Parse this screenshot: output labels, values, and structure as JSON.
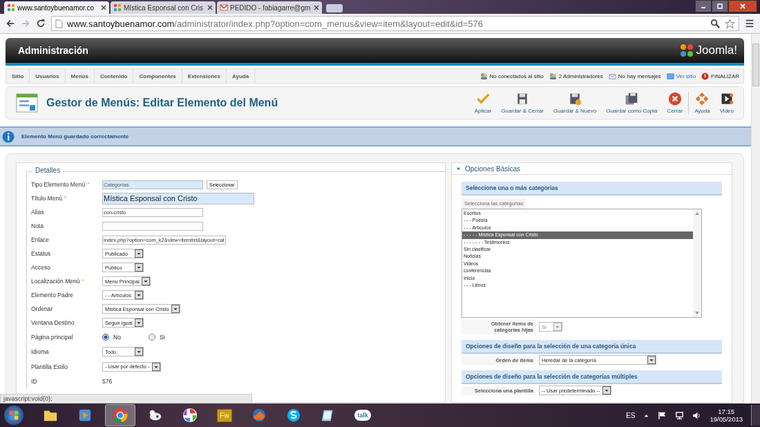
{
  "browser": {
    "tabs": [
      {
        "title": "www.santoybuenamor.co",
        "selected": true
      },
      {
        "title": "Mística Esponsal con Cris",
        "selected": false
      },
      {
        "title": "PEDIDO - fabiagarre@gm",
        "selected": false
      }
    ],
    "address": {
      "host": "www.santoybuenamor.com",
      "path": "/administrator/index.php?option=com_menus&view=item&layout=edit&id=576"
    }
  },
  "header": {
    "title": "Administración",
    "logo": "Joomla!"
  },
  "menu": [
    "Sitio",
    "Usuarios",
    "Menús",
    "Contenido",
    "Componentes",
    "Extensiones",
    "Ayuda"
  ],
  "status_links": [
    {
      "label": "No conectados al sitio",
      "kind": "text"
    },
    {
      "label": "2 Administradores",
      "kind": "text"
    },
    {
      "label": "No hay mensajes",
      "kind": "text"
    },
    {
      "label": "Ver sitio",
      "kind": "link"
    },
    {
      "label": "FINALIZAR",
      "kind": "text"
    }
  ],
  "page_title": "Gestor de Menús: Editar Elemento del Menú",
  "toolbar": [
    {
      "label": "Aplicar"
    },
    {
      "label": "Guardar & Cerrar"
    },
    {
      "label": "Guardar & Nuevo"
    },
    {
      "label": "Guardar como Copia"
    },
    {
      "label": "Cerrar"
    },
    {
      "label": "Ayuda"
    },
    {
      "label": "Video"
    }
  ],
  "message": "Elemento Menú guardado correctamente",
  "details": {
    "legend": "Detalles",
    "fields": [
      {
        "label": "Tipo Elemento Menú",
        "required_mark": "*",
        "kind": "input",
        "value": "Categorías",
        "highlighted": true,
        "button": "Seleccionar"
      },
      {
        "label": "Título Menú",
        "required_mark": "*",
        "kind": "large_input",
        "value": "Mística Esponsal con Cristo",
        "highlighted": true
      },
      {
        "label": "Alias",
        "kind": "input",
        "value": "con-cristo",
        "highlighted": false
      },
      {
        "label": "Nota",
        "kind": "input",
        "highlighted": false
      },
      {
        "label": "Enlace",
        "kind": "input",
        "value": "index.php?option=com_k2&view=itemlist&layout=cat",
        "highlighted": false
      },
      {
        "label": "Estatus",
        "kind": "select",
        "value": "Publicado"
      },
      {
        "label": "Acceso",
        "kind": "select",
        "value": "Público"
      },
      {
        "label": "Localización Menú",
        "required_mark": "*",
        "kind": "select",
        "value": "Menu Principal"
      },
      {
        "label": "Elemento Padre",
        "kind": "select",
        "value": "- - Artículos"
      },
      {
        "label": "Ordenar",
        "kind": "select",
        "value": "Mística Esponsal con Cristo"
      },
      {
        "label": "Ventana Destino",
        "kind": "select",
        "value": "Seguir igual"
      },
      {
        "label": "Página principal",
        "kind": "radio",
        "options": [
          {
            "label": "No",
            "selected": true
          },
          {
            "label": "Si",
            "selected": false
          }
        ]
      },
      {
        "label": "Idioma",
        "kind": "select",
        "value": "Todo"
      },
      {
        "label": "Plantilla Estilo",
        "kind": "select",
        "value": "- Usar por defecto -"
      },
      {
        "label": "ID",
        "kind": "text",
        "value": "576"
      }
    ]
  },
  "options": {
    "title": "Opciones Básicas",
    "expanded": true,
    "categories": {
      "header": "Seleccione una o más categorias",
      "tab": "Selecciona las categorías",
      "items": [
        {
          "label": "Escritos",
          "selected": false
        },
        {
          "label": "- - - Poesía",
          "selected": false
        },
        {
          "label": "- - - Artículos",
          "selected": false
        },
        {
          "label": "- - - - - Mística Esponsal con Cristo",
          "selected": true
        },
        {
          "label": "- - - - - - - Testimonios",
          "selected": false
        },
        {
          "label": "Sin clasificar",
          "selected": false
        },
        {
          "label": "Noticias",
          "selected": false
        },
        {
          "label": "Videos",
          "selected": false
        },
        {
          "label": "conferencias",
          "selected": false
        },
        {
          "label": "Inicio",
          "selected": false
        },
        {
          "label": "- - - Libros",
          "selected": false
        }
      ]
    },
    "child_items": {
      "label": "Obtener ítems de categorías hijas",
      "value": "Si",
      "disabled": true
    },
    "sections": [
      {
        "title": "Opciones de diseño para la selección de una categoria única",
        "row": {
          "label": "Orden de ítems",
          "value": "Heredar de la categoría"
        }
      },
      {
        "title": "Opciones de diseño para la selección de categorías múltiples",
        "row": {
          "label": "Selecciona una plantilla",
          "value": "-- Usar predeterminado --"
        }
      }
    ]
  },
  "status_bar": "javascript:void(0);",
  "taskbar": {
    "apps": [
      {
        "selected": false
      },
      {
        "selected": false
      },
      {
        "selected": true
      },
      {
        "selected": false
      },
      {
        "selected": false
      },
      {
        "label": "Fw",
        "selected": false
      },
      {
        "selected": false
      },
      {
        "selected": false
      },
      {
        "selected": false
      },
      {
        "label": "talk",
        "selected": false
      }
    ],
    "language": "ES",
    "time": "17:15",
    "date": "19/05/2013"
  }
}
